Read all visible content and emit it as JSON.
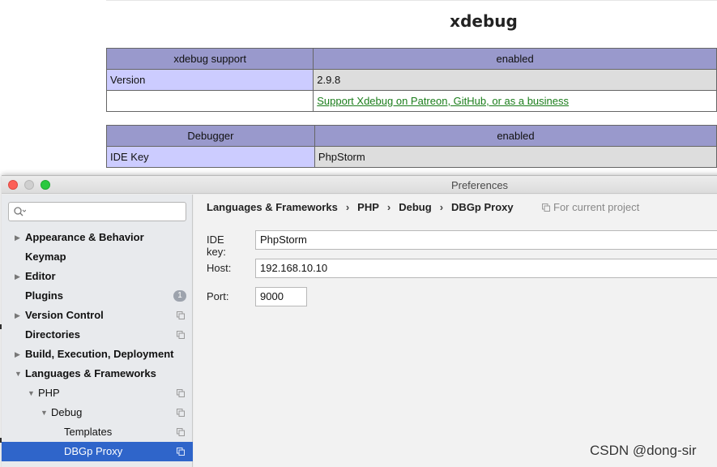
{
  "phpinfo": {
    "title": "xdebug",
    "table1": {
      "header": [
        "xdebug support",
        "enabled"
      ],
      "rows": [
        [
          "Version",
          "2.9.8"
        ]
      ],
      "link": "Support Xdebug on Patreon, GitHub, or as a business"
    },
    "table2": {
      "header": [
        "Debugger",
        "enabled"
      ],
      "rows": [
        [
          "IDE Key",
          "PhpStorm"
        ]
      ]
    }
  },
  "window": {
    "title": "Preferences",
    "search": {
      "placeholder": "",
      "value": ""
    },
    "tree": [
      {
        "label": "Appearance & Behavior",
        "arrow": "▶",
        "bold": true,
        "badge": "",
        "copy": false
      },
      {
        "label": "Keymap",
        "arrow": "",
        "bold": true,
        "badge": "",
        "copy": false
      },
      {
        "label": "Editor",
        "arrow": "▶",
        "bold": true,
        "badge": "",
        "copy": false
      },
      {
        "label": "Plugins",
        "arrow": "",
        "bold": true,
        "badge": "1",
        "copy": false
      },
      {
        "label": "Version Control",
        "arrow": "▶",
        "bold": true,
        "badge": "",
        "copy": true
      },
      {
        "label": "Directories",
        "arrow": "",
        "bold": true,
        "badge": "",
        "copy": true
      },
      {
        "label": "Build, Execution, Deployment",
        "arrow": "▶",
        "bold": true,
        "badge": "",
        "copy": false
      },
      {
        "label": "Languages & Frameworks",
        "arrow": "▼",
        "bold": true,
        "badge": "",
        "copy": false
      },
      {
        "label": "PHP",
        "arrow": "▼",
        "bold": false,
        "badge": "",
        "copy": true
      },
      {
        "label": "Debug",
        "arrow": "▼",
        "bold": false,
        "badge": "",
        "copy": true
      },
      {
        "label": "Templates",
        "arrow": "",
        "bold": false,
        "badge": "",
        "copy": true
      },
      {
        "label": "DBGp Proxy",
        "arrow": "",
        "bold": false,
        "badge": "",
        "copy": true,
        "selected": true
      }
    ],
    "breadcrumb": [
      "Languages & Frameworks",
      "PHP",
      "Debug",
      "DBGp Proxy"
    ],
    "breadcrumb_sep": "›",
    "scope_label": "For current project",
    "fields": {
      "ide_key": {
        "label": "IDE key:",
        "value": "PhpStorm"
      },
      "host": {
        "label": "Host:",
        "value": "192.168.10.10"
      },
      "port": {
        "label": "Port:",
        "value": "9000"
      }
    }
  },
  "watermark": "CSDN @dong-sir",
  "colors": {
    "php_header": "#9999cc",
    "php_key": "#ccccff",
    "php_value": "#dddddd",
    "selection": "#2f65ca",
    "close": "#fc5f57",
    "maximize": "#2ac93f"
  }
}
